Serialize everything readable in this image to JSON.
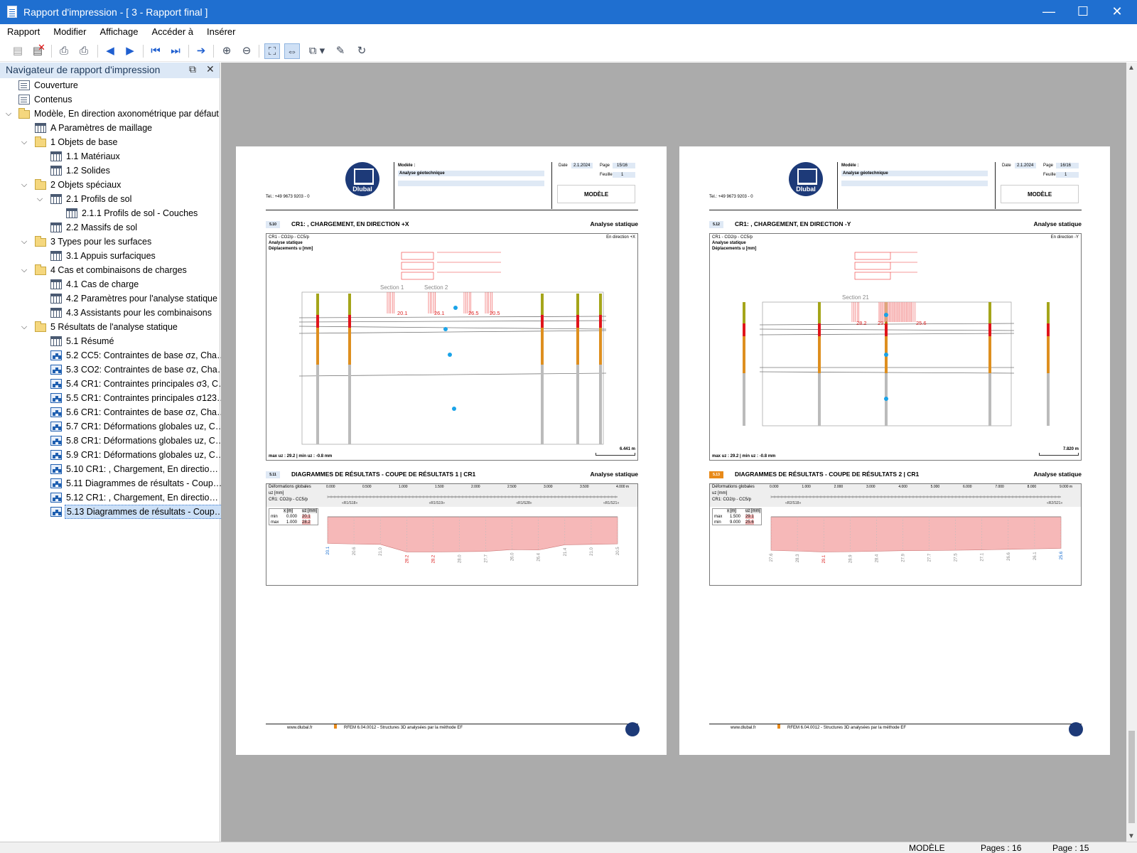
{
  "window": {
    "title": "Rapport d'impression - [ 3 - Rapport final ]",
    "minimize": "—",
    "maximize": "☐",
    "close": "✕"
  },
  "menu": [
    "Rapport",
    "Modifier",
    "Affichage",
    "Accéder à",
    "Insérer"
  ],
  "navigator": {
    "title": "Navigateur de rapport d'impression",
    "items": [
      {
        "label": "Couverture",
        "icon": "doc",
        "level": 1
      },
      {
        "label": "Contenus",
        "icon": "doc",
        "level": 1
      },
      {
        "label": "Modèle, En direction axonométrique par défaut",
        "icon": "folder",
        "level": 0,
        "expanded": true
      },
      {
        "label": "A Paramètres de maillage",
        "icon": "table",
        "level": 2
      },
      {
        "label": "1 Objets de base",
        "icon": "folder",
        "level": 1,
        "expanded": true
      },
      {
        "label": "1.1 Matériaux",
        "icon": "table",
        "level": 3
      },
      {
        "label": "1.2 Solides",
        "icon": "table",
        "level": 3
      },
      {
        "label": "2 Objets spéciaux",
        "icon": "folder",
        "level": 1,
        "expanded": true
      },
      {
        "label": "2.1 Profils de sol",
        "icon": "table",
        "level": 2,
        "expanded": true
      },
      {
        "label": "2.1.1 Profils de sol - Couches",
        "icon": "table",
        "level": 4
      },
      {
        "label": "2.2 Massifs de sol",
        "icon": "table",
        "level": 3
      },
      {
        "label": "3 Types pour les surfaces",
        "icon": "folder",
        "level": 1,
        "expanded": true
      },
      {
        "label": "3.1 Appuis surfaciques",
        "icon": "table",
        "level": 3
      },
      {
        "label": "4 Cas et combinaisons de charges",
        "icon": "folder",
        "level": 1,
        "expanded": true
      },
      {
        "label": "4.1 Cas de charge",
        "icon": "table",
        "level": 3
      },
      {
        "label": "4.2 Paramètres pour l'analyse statique",
        "icon": "table",
        "level": 3
      },
      {
        "label": "4.3 Assistants pour les combinaisons",
        "icon": "table",
        "level": 3
      },
      {
        "label": "5 Résultats de l'analyse statique",
        "icon": "folder",
        "level": 1,
        "expanded": true
      },
      {
        "label": "5.1 Résumé",
        "icon": "table",
        "level": 3
      },
      {
        "label": "5.2 CC5: Contraintes de base σz, Cha…",
        "icon": "img",
        "level": 3
      },
      {
        "label": "5.3 CO2: Contraintes de base σz, Cha…",
        "icon": "img",
        "level": 3
      },
      {
        "label": "5.4 CR1: Contraintes principales σ3, C…",
        "icon": "img",
        "level": 3
      },
      {
        "label": "5.5 CR1: Contraintes principales σ123…",
        "icon": "img",
        "level": 3
      },
      {
        "label": "5.6 CR1: Contraintes de base σz, Cha…",
        "icon": "img",
        "level": 3
      },
      {
        "label": "5.7 CR1: Déformations globales uz, C…",
        "icon": "img",
        "level": 3
      },
      {
        "label": "5.8 CR1: Déformations globales uz, C…",
        "icon": "img",
        "level": 3
      },
      {
        "label": "5.9 CR1: Déformations globales uz, C…",
        "icon": "img",
        "level": 3
      },
      {
        "label": "5.10 CR1: , Chargement, En directio…",
        "icon": "img",
        "level": 3
      },
      {
        "label": "5.11 Diagrammes de résultats - Coup…",
        "icon": "img",
        "level": 3
      },
      {
        "label": "5.12 CR1: , Chargement, En directio…",
        "icon": "img",
        "level": 3
      },
      {
        "label": "5.13 Diagrammes de résultats - Coup…",
        "icon": "img",
        "level": 3,
        "selected": true
      }
    ]
  },
  "pages": [
    {
      "date_label": "Date",
      "date": "2.1.2024",
      "page_label": "Page",
      "page": "15/16",
      "sheet_label": "Feuille",
      "sheet": "1",
      "model_label": "Modèle :",
      "model": "Analyse géotechnique",
      "section_title": "MODÈLE",
      "tel": "Tel.: +49 9673 9203 - 0",
      "s1_num": "5.10",
      "s1_title": "CR1: , CHARGEMENT, EN DIRECTION +X",
      "s1_right": "Analyse statique",
      "fig_l1": "CR1 - CO2/p - CC5/p",
      "fig_l2": "Analyse statique",
      "fig_l3": "Déplacements u [mm]",
      "fig_dir": "En direction +X",
      "fig_max": "max uz : 29.2 | min uz : -0.8 mm",
      "scale": "6.441 m",
      "labels": [
        "Section 1",
        "Section 2"
      ],
      "values": [
        "20.1",
        "26.1",
        "26.5",
        "20.5"
      ],
      "s2_num": "5.11",
      "s2_title": "DIAGRAMMES DE RÉSULTATS - COUPE DE RÉSULTATS 1 | CR1",
      "s2_right": "Analyse statique",
      "d_l1": "Déformations globales",
      "d_l2": "uz [mm]",
      "d_l3": "CR1: CO2/p - CC5/p",
      "ticks": [
        "0.000",
        "0.500",
        "1.000",
        "1.500",
        "2.000",
        "2.500",
        "3.000",
        "3.500",
        "4.000 m"
      ],
      "ruler_labels": [
        "«R1/S18»",
        "«R1/S19»",
        "«R1/S28»",
        "«R1/S21»"
      ],
      "tbl_head": [
        "x [m]",
        "uz [mm]"
      ],
      "tbl_rows": [
        [
          "min",
          "0.000",
          "20.1"
        ],
        [
          "max",
          "1.000",
          "28.2"
        ]
      ],
      "diagram_values": [
        "20.1",
        "20.6",
        "21.0",
        "28.2",
        "28.2",
        "28.0",
        "27.7",
        "26.0",
        "26.4",
        "21.4",
        "21.0",
        "20.5"
      ],
      "footer_web": "www.dlubal.fr",
      "footer_prog": "RFEM 6.04.0012 - Structures 3D analysées par la méthode EF"
    },
    {
      "date_label": "Date",
      "date": "2.1.2024",
      "page_label": "Page",
      "page": "16/16",
      "sheet_label": "Feuille",
      "sheet": "1",
      "model_label": "Modèle :",
      "model": "Analyse géotechnique",
      "section_title": "MODÈLE",
      "tel": "Tel.: +49 9673 9203 - 0",
      "s1_num": "5.12",
      "s1_title": "CR1: , CHARGEMENT, EN DIRECTION -Y",
      "s1_right": "Analyse statique",
      "fig_l1": "CR1 - CO2/p - CC5/p",
      "fig_l2": "Analyse statique",
      "fig_l3": "Déplacements u [mm]",
      "fig_dir": "En direction -Y",
      "fig_max": "max uz : 29.2 | min uz : -0.8 mm",
      "scale": "7.820 m",
      "labels": [
        "Section 21"
      ],
      "values": [
        "28.2",
        "29.1",
        "25.6"
      ],
      "s2_num": "5.13",
      "s2_title": "DIAGRAMMES DE RÉSULTATS - COUPE DE RÉSULTATS 2 | CR1",
      "s2_right": "Analyse statique",
      "d_l1": "Déformations globales",
      "d_l2": "uz [mm]",
      "d_l3": "CR1: CO2/p - CC5/p",
      "ticks": [
        "0.000",
        "1.000",
        "2.000",
        "3.000",
        "4.000",
        "5.000",
        "6.000",
        "7.000",
        "8.000",
        "9.000 m"
      ],
      "ruler_labels": [
        "«R2/S18»",
        "«R2/S21»"
      ],
      "tbl_head": [
        "x [m]",
        "uz [mm]"
      ],
      "tbl_rows": [
        [
          "max",
          "1.500",
          "29.1"
        ],
        [
          "min",
          "9.000",
          "25.6"
        ]
      ],
      "diagram_values": [
        "27.6",
        "28.3",
        "29.1",
        "28.9",
        "28.4",
        "27.9",
        "27.7",
        "27.5",
        "27.1",
        "26.6",
        "26.1",
        "25.6"
      ],
      "footer_web": "www.dlubal.fr",
      "footer_prog": "RFEM 6.04.0012 - Structures 3D analysées par la méthode EF"
    }
  ],
  "status": {
    "mode": "MODÈLE",
    "pages": "Pages : 16",
    "page": "Page : 15"
  },
  "icons": [
    "new-report-icon",
    "delete-icon",
    "print-icon",
    "print-multiple-icon",
    "previous-icon",
    "next-icon",
    "first-page-icon",
    "last-page-icon",
    "goto-icon",
    "zoom-in-icon",
    "zoom-out-icon",
    "fit-page-icon",
    "fit-width-icon",
    "multi-page-icon",
    "properties-icon",
    "refresh-icon"
  ],
  "colors": {
    "titlebar": "#1f6fd0",
    "page_bg": "#ababab",
    "selection": "#cce0f7",
    "diagram_fill": "#f6b8b8",
    "accent_orange": "#e88a19"
  }
}
